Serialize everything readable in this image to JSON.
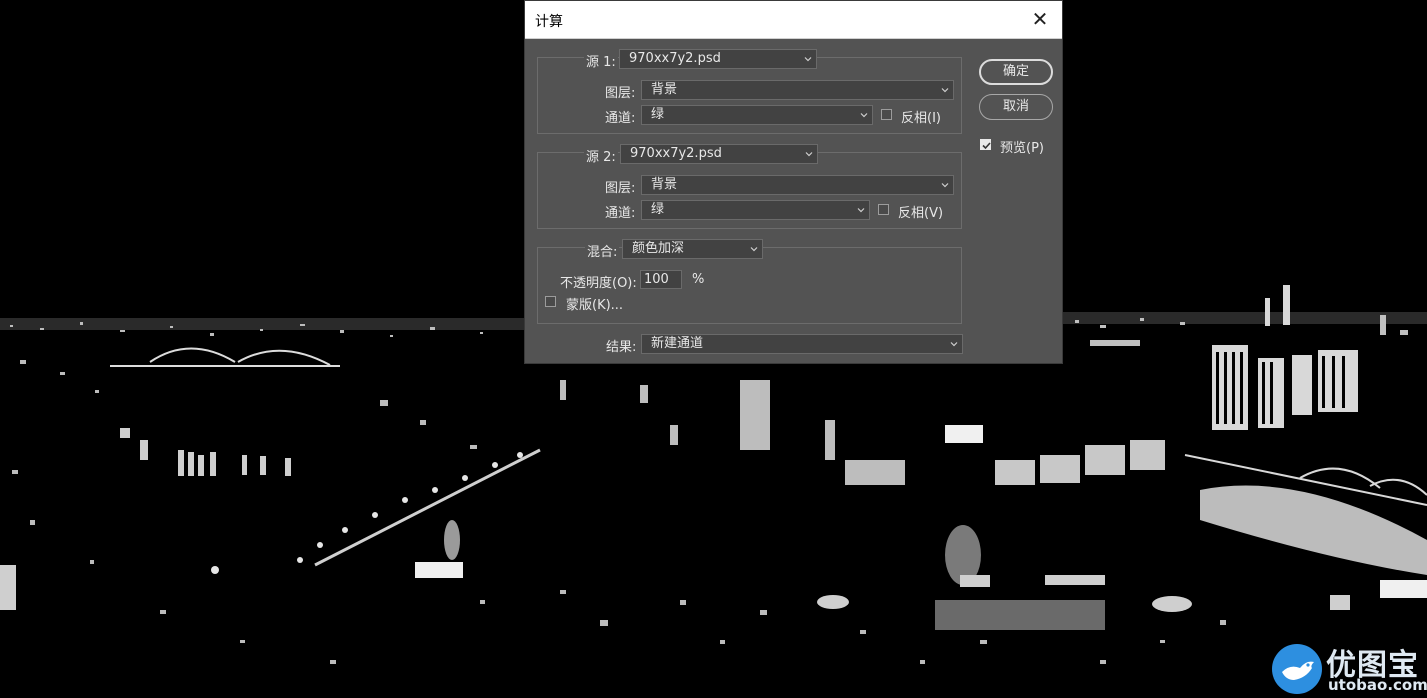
{
  "dialog": {
    "title": "计算",
    "close_glyph": "✕",
    "source1": {
      "label": "源 1:",
      "file": "970xx7y2.psd",
      "layer_label": "图层:",
      "layer": "背景",
      "channel_label": "通道:",
      "channel": "绿",
      "invert_label": "反相(I)",
      "invert_checked": false
    },
    "source2": {
      "label": "源 2:",
      "file": "970xx7y2.psd",
      "layer_label": "图层:",
      "layer": "背景",
      "channel_label": "通道:",
      "channel": "绿",
      "invert_label": "反相(V)",
      "invert_checked": false
    },
    "blend": {
      "label": "混合:",
      "mode": "颜色加深",
      "opacity_label": "不透明度(O):",
      "opacity_value": "100",
      "opacity_unit": "%",
      "mask_label": "蒙版(K)...",
      "mask_checked": false
    },
    "result": {
      "label": "结果:",
      "value": "新建通道"
    },
    "buttons": {
      "ok": "确定",
      "cancel": "取消"
    },
    "preview": {
      "label": "预览(P)",
      "checked": true
    }
  },
  "watermark": {
    "brand_cn": "优图宝",
    "brand_en": "utobao.com"
  },
  "colors": {
    "dialog_bg": "#535353",
    "titlebar_bg": "#ffffff",
    "field_bg": "#424242",
    "text": "#e8e8e8",
    "watermark_blue": "#2d8fe0"
  },
  "icons": {
    "close": "close-icon",
    "dropdown": "chevron-down-icon",
    "check": "checkmark-icon",
    "watermark_logo": "bird-logo-icon"
  }
}
